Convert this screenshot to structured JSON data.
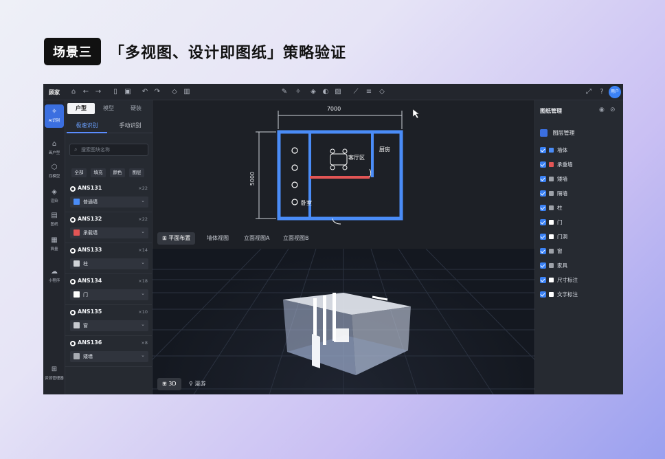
{
  "slide": {
    "badge": "场景三",
    "heading": "「多视图、设计即图纸」策略验证"
  },
  "app": {
    "brand": "顾家",
    "user_label": "用户",
    "toolbar_icons": [
      "home-icon",
      "back-icon",
      "forward-icon",
      "file-icon",
      "save-icon",
      "undo-icon",
      "redo-icon",
      "eraser-icon",
      "trash-icon"
    ],
    "center_tools": [
      "pen-icon",
      "magic-icon",
      "layers-icon",
      "palette-icon",
      "image-icon",
      "ruler-icon",
      "align-icon",
      "erase-icon"
    ],
    "right_tools": [
      "fullscreen-icon",
      "help-icon"
    ]
  },
  "rail": {
    "items": [
      {
        "label": "AI识别",
        "icon": "ai-icon"
      },
      {
        "label": "画户型",
        "icon": "house-icon"
      },
      {
        "label": "找模型",
        "icon": "cube-icon"
      },
      {
        "label": "渲染",
        "icon": "bucket-icon"
      },
      {
        "label": "图纸",
        "icon": "doc-icon"
      },
      {
        "label": "算量",
        "icon": "calc-icon"
      },
      {
        "label": "小程序",
        "icon": "cloud-icon"
      },
      {
        "label": "资源管理器",
        "icon": "tree-icon"
      }
    ]
  },
  "left": {
    "tabs": [
      "户型",
      "模型",
      "硬装"
    ],
    "subtabs": [
      "极速识别",
      "手动识别"
    ],
    "search_placeholder": "搜索图块名称",
    "filters": [
      "全部",
      "填充",
      "颜色",
      "图层"
    ],
    "items": [
      {
        "name": "ANS131",
        "count": "×22",
        "type": "普通墙",
        "color": "#4a8cf7"
      },
      {
        "name": "ANS132",
        "count": "×22",
        "type": "承载墙",
        "color": "#e25555"
      },
      {
        "name": "ANS133",
        "count": "×14",
        "type": "柱",
        "color": "#d0d3d8"
      },
      {
        "name": "ANS134",
        "count": "×18",
        "type": "门",
        "color": "#ffffff"
      },
      {
        "name": "ANS135",
        "count": "×10",
        "type": "窗",
        "color": "#c7cad0"
      },
      {
        "name": "ANS136",
        "count": "×8",
        "type": "矮墙",
        "color": "#a8acb3"
      }
    ]
  },
  "plan": {
    "width_dim": "7000",
    "height_dim": "5000",
    "rooms": [
      "客厅区",
      "厨房",
      "卧室"
    ]
  },
  "view_tabs": [
    "平面布置",
    "墙体视图",
    "立面视图A",
    "立面视图B"
  ],
  "bottom": {
    "view3d_label": "3D",
    "roam_label": "漫游"
  },
  "right": {
    "title": "图纸管理",
    "section": "图层管理",
    "layers": [
      {
        "label": "墙体",
        "color": "#4a8cf7"
      },
      {
        "label": "承重墙",
        "color": "#e25555"
      },
      {
        "label": "矮墙",
        "color": "#9ea2a9"
      },
      {
        "label": "隔墙",
        "color": "#9ea2a9"
      },
      {
        "label": "柱",
        "color": "#9ea2a9"
      },
      {
        "label": "门",
        "color": "#ffffff"
      },
      {
        "label": "门洞",
        "color": "#ffffff"
      },
      {
        "label": "窗",
        "color": "#9ea2a9"
      },
      {
        "label": "家具",
        "color": "#9ea2a9"
      },
      {
        "label": "尺寸标注",
        "color": "#ffffff"
      },
      {
        "label": "文字标注",
        "color": "#ffffff"
      }
    ]
  }
}
